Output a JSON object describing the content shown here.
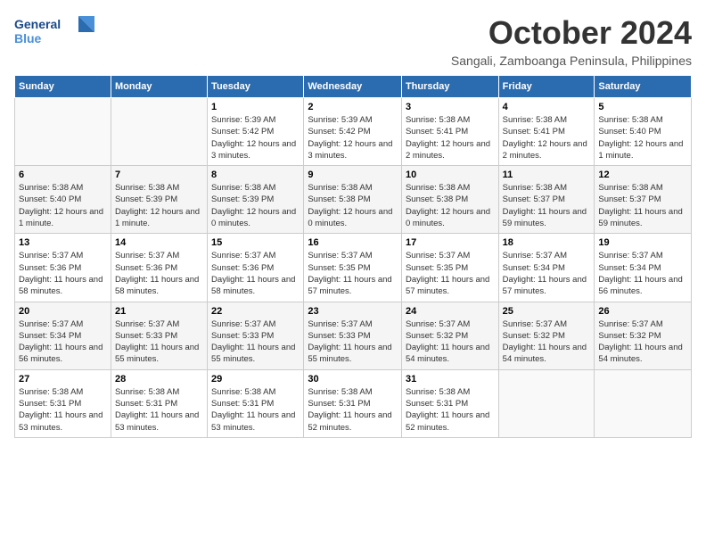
{
  "logo": {
    "line1": "General",
    "line2": "Blue"
  },
  "title": "October 2024",
  "subtitle": "Sangali, Zamboanga Peninsula, Philippines",
  "days_of_week": [
    "Sunday",
    "Monday",
    "Tuesday",
    "Wednesday",
    "Thursday",
    "Friday",
    "Saturday"
  ],
  "weeks": [
    [
      {
        "day": "",
        "info": ""
      },
      {
        "day": "",
        "info": ""
      },
      {
        "day": "1",
        "info": "Sunrise: 5:39 AM\nSunset: 5:42 PM\nDaylight: 12 hours and 3 minutes."
      },
      {
        "day": "2",
        "info": "Sunrise: 5:39 AM\nSunset: 5:42 PM\nDaylight: 12 hours and 3 minutes."
      },
      {
        "day": "3",
        "info": "Sunrise: 5:38 AM\nSunset: 5:41 PM\nDaylight: 12 hours and 2 minutes."
      },
      {
        "day": "4",
        "info": "Sunrise: 5:38 AM\nSunset: 5:41 PM\nDaylight: 12 hours and 2 minutes."
      },
      {
        "day": "5",
        "info": "Sunrise: 5:38 AM\nSunset: 5:40 PM\nDaylight: 12 hours and 1 minute."
      }
    ],
    [
      {
        "day": "6",
        "info": "Sunrise: 5:38 AM\nSunset: 5:40 PM\nDaylight: 12 hours and 1 minute."
      },
      {
        "day": "7",
        "info": "Sunrise: 5:38 AM\nSunset: 5:39 PM\nDaylight: 12 hours and 1 minute."
      },
      {
        "day": "8",
        "info": "Sunrise: 5:38 AM\nSunset: 5:39 PM\nDaylight: 12 hours and 0 minutes."
      },
      {
        "day": "9",
        "info": "Sunrise: 5:38 AM\nSunset: 5:38 PM\nDaylight: 12 hours and 0 minutes."
      },
      {
        "day": "10",
        "info": "Sunrise: 5:38 AM\nSunset: 5:38 PM\nDaylight: 12 hours and 0 minutes."
      },
      {
        "day": "11",
        "info": "Sunrise: 5:38 AM\nSunset: 5:37 PM\nDaylight: 11 hours and 59 minutes."
      },
      {
        "day": "12",
        "info": "Sunrise: 5:38 AM\nSunset: 5:37 PM\nDaylight: 11 hours and 59 minutes."
      }
    ],
    [
      {
        "day": "13",
        "info": "Sunrise: 5:37 AM\nSunset: 5:36 PM\nDaylight: 11 hours and 58 minutes."
      },
      {
        "day": "14",
        "info": "Sunrise: 5:37 AM\nSunset: 5:36 PM\nDaylight: 11 hours and 58 minutes."
      },
      {
        "day": "15",
        "info": "Sunrise: 5:37 AM\nSunset: 5:36 PM\nDaylight: 11 hours and 58 minutes."
      },
      {
        "day": "16",
        "info": "Sunrise: 5:37 AM\nSunset: 5:35 PM\nDaylight: 11 hours and 57 minutes."
      },
      {
        "day": "17",
        "info": "Sunrise: 5:37 AM\nSunset: 5:35 PM\nDaylight: 11 hours and 57 minutes."
      },
      {
        "day": "18",
        "info": "Sunrise: 5:37 AM\nSunset: 5:34 PM\nDaylight: 11 hours and 57 minutes."
      },
      {
        "day": "19",
        "info": "Sunrise: 5:37 AM\nSunset: 5:34 PM\nDaylight: 11 hours and 56 minutes."
      }
    ],
    [
      {
        "day": "20",
        "info": "Sunrise: 5:37 AM\nSunset: 5:34 PM\nDaylight: 11 hours and 56 minutes."
      },
      {
        "day": "21",
        "info": "Sunrise: 5:37 AM\nSunset: 5:33 PM\nDaylight: 11 hours and 55 minutes."
      },
      {
        "day": "22",
        "info": "Sunrise: 5:37 AM\nSunset: 5:33 PM\nDaylight: 11 hours and 55 minutes."
      },
      {
        "day": "23",
        "info": "Sunrise: 5:37 AM\nSunset: 5:33 PM\nDaylight: 11 hours and 55 minutes."
      },
      {
        "day": "24",
        "info": "Sunrise: 5:37 AM\nSunset: 5:32 PM\nDaylight: 11 hours and 54 minutes."
      },
      {
        "day": "25",
        "info": "Sunrise: 5:37 AM\nSunset: 5:32 PM\nDaylight: 11 hours and 54 minutes."
      },
      {
        "day": "26",
        "info": "Sunrise: 5:37 AM\nSunset: 5:32 PM\nDaylight: 11 hours and 54 minutes."
      }
    ],
    [
      {
        "day": "27",
        "info": "Sunrise: 5:38 AM\nSunset: 5:31 PM\nDaylight: 11 hours and 53 minutes."
      },
      {
        "day": "28",
        "info": "Sunrise: 5:38 AM\nSunset: 5:31 PM\nDaylight: 11 hours and 53 minutes."
      },
      {
        "day": "29",
        "info": "Sunrise: 5:38 AM\nSunset: 5:31 PM\nDaylight: 11 hours and 53 minutes."
      },
      {
        "day": "30",
        "info": "Sunrise: 5:38 AM\nSunset: 5:31 PM\nDaylight: 11 hours and 52 minutes."
      },
      {
        "day": "31",
        "info": "Sunrise: 5:38 AM\nSunset: 5:31 PM\nDaylight: 11 hours and 52 minutes."
      },
      {
        "day": "",
        "info": ""
      },
      {
        "day": "",
        "info": ""
      }
    ]
  ]
}
